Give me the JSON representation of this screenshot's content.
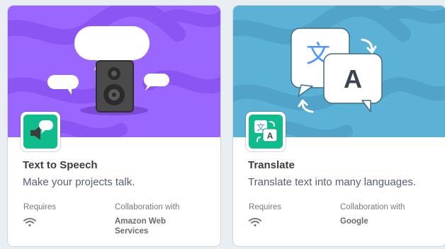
{
  "cards": [
    {
      "title": "Text to Speech",
      "description": "Make your projects talk.",
      "requires_label": "Requires",
      "requires_icon": "wifi-icon",
      "collab_label": "Collaboration with",
      "collab_name_line1": "Amazon Web",
      "collab_name_line2": "Services",
      "hero_color": "#9966ff",
      "badge_color": "#0fbd8c",
      "icon": "speaker-speech-icon"
    },
    {
      "title": "Translate",
      "description": "Translate text into many languages.",
      "requires_label": "Requires",
      "requires_icon": "wifi-icon",
      "collab_label": "Collaboration with",
      "collab_name_line1": "Google",
      "collab_name_line2": "",
      "hero_color": "#5cb1d6",
      "badge_color": "#0fbd8c",
      "icon": "translate-icon",
      "hero_glyph_1": "文",
      "hero_glyph_2": "A"
    }
  ]
}
